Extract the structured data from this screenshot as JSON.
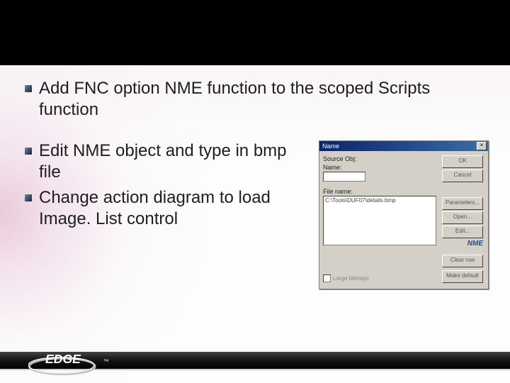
{
  "bullets": {
    "b1": "Add FNC option NME function to the scoped Scripts function",
    "b2": "Edit NME object and type in bmp file",
    "b3": "Change action diagram to load Image. List control"
  },
  "dialog": {
    "title": "Name",
    "label_source": "Source Obj:",
    "label_name": "Name:",
    "label_filename": "File name:",
    "list_item": "C:\\Tools\\DUF07\\details.bmp",
    "btn_ok": "OK",
    "btn_cancel": "Cancel",
    "btn_param": "Parameters...",
    "btn_open": "Open...",
    "btn_edit": "Edit...",
    "btn_clear": "Clear row",
    "btn_default": "Make default",
    "nme_badge": "NME",
    "chk_large": "Large bitmaps"
  },
  "footer": {
    "brand": "EDGE"
  }
}
